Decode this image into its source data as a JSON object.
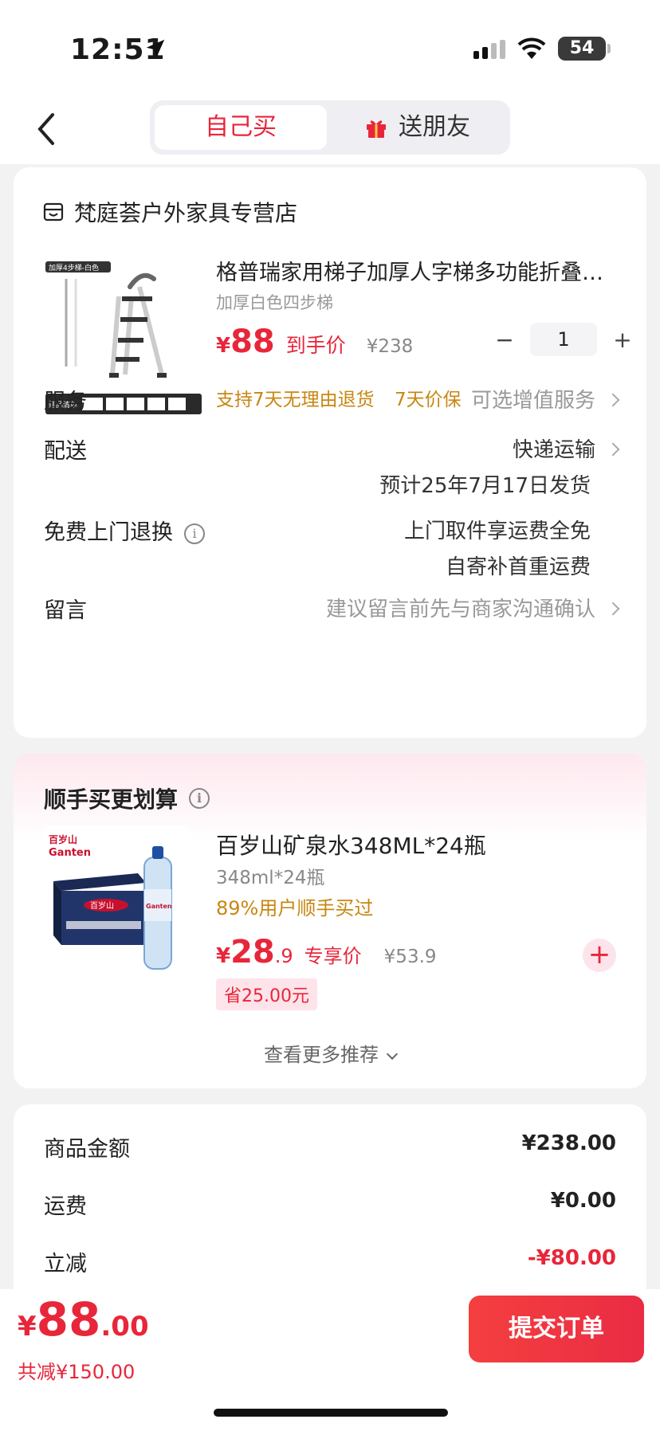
{
  "status": {
    "time": "12:51",
    "battery": "54"
  },
  "nav": {
    "tab_self": "自己买",
    "tab_gift": "送朋友"
  },
  "store": {
    "name": "梵庭荟户外家具专营店"
  },
  "product": {
    "title": "格普瑞家用梯子加厚人字梯多功能折叠…",
    "spec": "加厚白色四步梯",
    "yen": "¥",
    "price": "88",
    "price_tag": "到手价",
    "orig_price": "¥238",
    "qty": "1",
    "guarantees": [
      "支持7天无理由退货",
      "7天价保"
    ],
    "image_labels": {
      "top": "加厚4步梯-白色",
      "gift": "赠品清单"
    }
  },
  "rows": {
    "service_label": "服务",
    "service_value": "可选增值服务",
    "delivery_label": "配送",
    "delivery_value": "快递运输",
    "delivery_eta": "预计25年7月17日发货",
    "return_label": "免费上门退换",
    "return_value_1": "上门取件享运费全免",
    "return_value_2": "自寄补首重运费",
    "note_label": "留言",
    "note_placeholder": "建议留言前先与商家沟通确认"
  },
  "bundle": {
    "section_title": "顺手买更划算",
    "title": "百岁山矿泉水348ML*24瓶",
    "spec": "348ml*24瓶",
    "bought": "89%用户顺手买过",
    "yen": "¥",
    "price_int": "28",
    "price_dec": ".9",
    "price_tag": "专享价",
    "orig_price": "¥53.9",
    "save": "省25.00元",
    "more": "查看更多推荐",
    "brand": "Ganten",
    "brand_cn": "百岁山"
  },
  "summary": {
    "goods_label": "商品金额",
    "goods_value": "¥238.00",
    "ship_label": "运费",
    "ship_value": "¥0.00",
    "discount_label": "立减",
    "discount_value": "-¥80.00"
  },
  "bottom": {
    "yen": "¥",
    "total_int": "88",
    "total_dec": ".00",
    "total_save": "共减¥150.00",
    "submit": "提交订单"
  },
  "colors": {
    "accent": "#e8263a",
    "gold": "#c88712",
    "bg": "#f2f2f2"
  }
}
